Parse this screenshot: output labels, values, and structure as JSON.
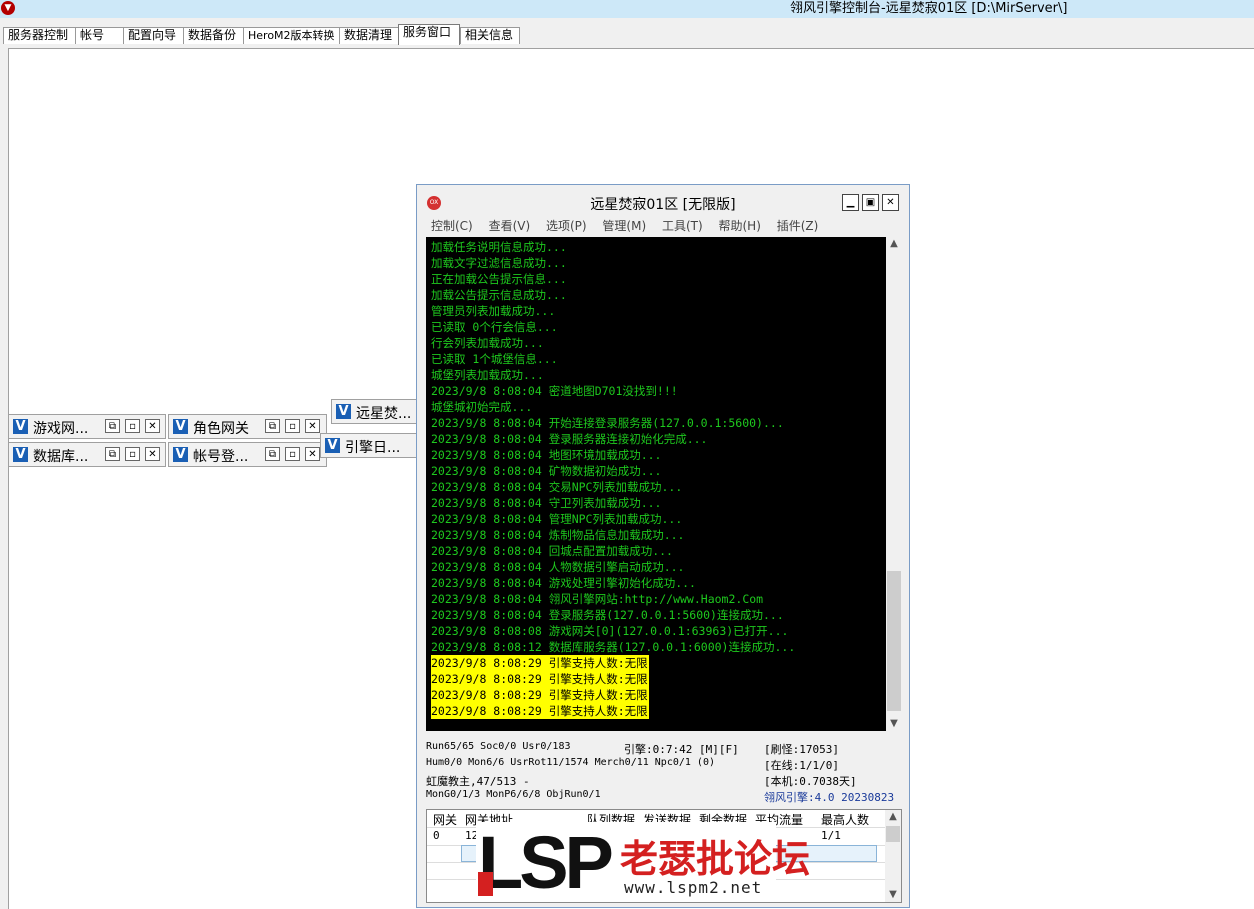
{
  "window": {
    "title": "翎风引擎控制台-远星焚寂01区 [D:\\MirServer\\]"
  },
  "tabs": [
    {
      "label": "服务器控制"
    },
    {
      "label": "帐号"
    },
    {
      "label": "配置向导"
    },
    {
      "label": "数据备份"
    },
    {
      "label": "HeroM2版本转换"
    },
    {
      "label": "数据清理"
    },
    {
      "label": "服务窗口",
      "active": true
    },
    {
      "label": "相关信息"
    }
  ],
  "mini_windows": [
    {
      "title": "游戏网..."
    },
    {
      "title": "角色网关"
    },
    {
      "title": "远星焚..."
    },
    {
      "title": "数据库..."
    },
    {
      "title": "帐号登..."
    },
    {
      "title": "引擎日..."
    }
  ],
  "server": {
    "title": "远星焚寂01区 [无限版]",
    "menu": [
      "控制(C)",
      "查看(V)",
      "选项(P)",
      "管理(M)",
      "工具(T)",
      "帮助(H)",
      "插件(Z)"
    ],
    "log": [
      {
        "text": "加载任务说明信息成功..."
      },
      {
        "text": "加载文字过滤信息成功..."
      },
      {
        "text": "正在加载公告提示信息..."
      },
      {
        "text": "加载公告提示信息成功..."
      },
      {
        "text": "管理员列表加载成功..."
      },
      {
        "text": "已读取 0个行会信息..."
      },
      {
        "text": "行会列表加载成功..."
      },
      {
        "text": "已读取 1个城堡信息..."
      },
      {
        "text": "城堡列表加载成功..."
      },
      {
        "text": "2023/9/8 8:08:04 密道地图D701没找到!!!"
      },
      {
        "text": "城堡城初始完成..."
      },
      {
        "text": "2023/9/8 8:08:04 开始连接登录服务器(127.0.0.1:5600)..."
      },
      {
        "text": "2023/9/8 8:08:04 登录服务器连接初始化完成..."
      },
      {
        "text": "2023/9/8 8:08:04 地图环境加载成功..."
      },
      {
        "text": "2023/9/8 8:08:04 矿物数据初始成功..."
      },
      {
        "text": "2023/9/8 8:08:04 交易NPC列表加载成功..."
      },
      {
        "text": "2023/9/8 8:08:04 守卫列表加载成功..."
      },
      {
        "text": "2023/9/8 8:08:04 管理NPC列表加载成功..."
      },
      {
        "text": "2023/9/8 8:08:04 炼制物品信息加载成功..."
      },
      {
        "text": "2023/9/8 8:08:04 回城点配置加载成功..."
      },
      {
        "text": "2023/9/8 8:08:04 人物数据引擎启动成功..."
      },
      {
        "text": "2023/9/8 8:08:04 游戏处理引擎初始化成功..."
      },
      {
        "text": "2023/9/8 8:08:04 翎风引擎网站:http://www.Haom2.Com"
      },
      {
        "text": "2023/9/8 8:08:04 登录服务器(127.0.0.1:5600)连接成功..."
      },
      {
        "text": "2023/9/8 8:08:08 游戏网关[0](127.0.0.1:63963)已打开..."
      },
      {
        "text": "2023/9/8 8:08:12 数据库服务器(127.0.0.1:6000)连接成功..."
      },
      {
        "text": "2023/9/8 8:08:29 引擎支持人数:无限",
        "highlight": true
      },
      {
        "text": "2023/9/8 8:08:29 引擎支持人数:无限",
        "highlight": true
      },
      {
        "text": "2023/9/8 8:08:29 引擎支持人数:无限",
        "highlight": true
      },
      {
        "text": "2023/9/8 8:08:29 引擎支持人数:无限",
        "highlight": true
      }
    ],
    "status": {
      "run": "Run65/65 Soc0/0 Usr0/183",
      "engine_time": "引擎:0:7:42 [M][F]",
      "monster": "[刷怪:17053]",
      "hum": "Hum0/0 Mon6/6 UsrRot11/1574 Merch0/11 Npc0/1 (0)",
      "online": "[在线:1/1/0]",
      "boss": "虹魔教主,47/513 -",
      "local": "[本机:0.7038天]",
      "mong": "MonG0/1/3 MonP6/6/8 ObjRun0/1",
      "version": "翎风引擎:4.0 20230823",
      "version_color": "#1a3a9a"
    },
    "grid": {
      "headers": [
        "网关",
        "网关地址",
        "队列数据",
        "发送数据",
        "剩余数据",
        "平均流量",
        "最高人数"
      ],
      "rows": [
        {
          "id": "0",
          "addr": "12",
          "max": "1/1"
        }
      ]
    }
  },
  "watermark": {
    "logo": "LSP",
    "forum": "老瑟批论坛",
    "url": "www.lspm2.net"
  }
}
